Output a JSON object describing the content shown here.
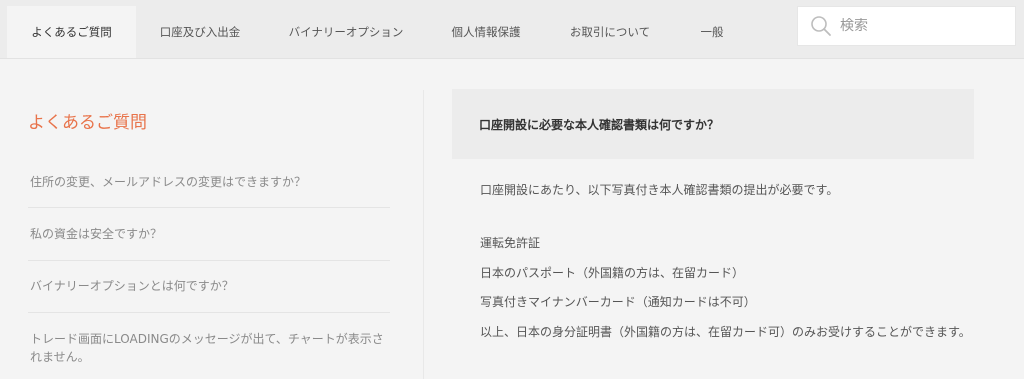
{
  "nav": {
    "tabs": [
      {
        "label": "よくあるご質問"
      },
      {
        "label": "口座及び入出金"
      },
      {
        "label": "バイナリーオプション"
      },
      {
        "label": "個人情報保護"
      },
      {
        "label": "お取引について"
      },
      {
        "label": "一般"
      }
    ],
    "search_placeholder": "検索"
  },
  "sidebar": {
    "title": "よくあるご質問",
    "items": [
      {
        "label": "住所の変更、メールアドレスの変更はできますか？"
      },
      {
        "label": "私の資金は安全ですか？"
      },
      {
        "label": "バイナリーオプションとは何ですか？"
      },
      {
        "label": "トレード画面にLOADINGのメッセージが出て、チャートが表示されません。"
      }
    ]
  },
  "content": {
    "question": "口座開設に必要な本人確認書類は何ですか？",
    "intro": "口座開設にあたり、以下写真付き本人確認書類の提出が必要です。",
    "documents": [
      "運転免許証",
      "日本のパスポート（外国籍の方は、在留カード）",
      "写真付きマイナンバーカード（通知カードは不可）"
    ],
    "note": "以上、日本の身分証明書（外国籍の方は、在留カード可）のみお受けすることができます。"
  },
  "colors": {
    "accent": "#e8734a",
    "nav_bg": "#ececec",
    "page_bg": "#f4f4f4"
  }
}
